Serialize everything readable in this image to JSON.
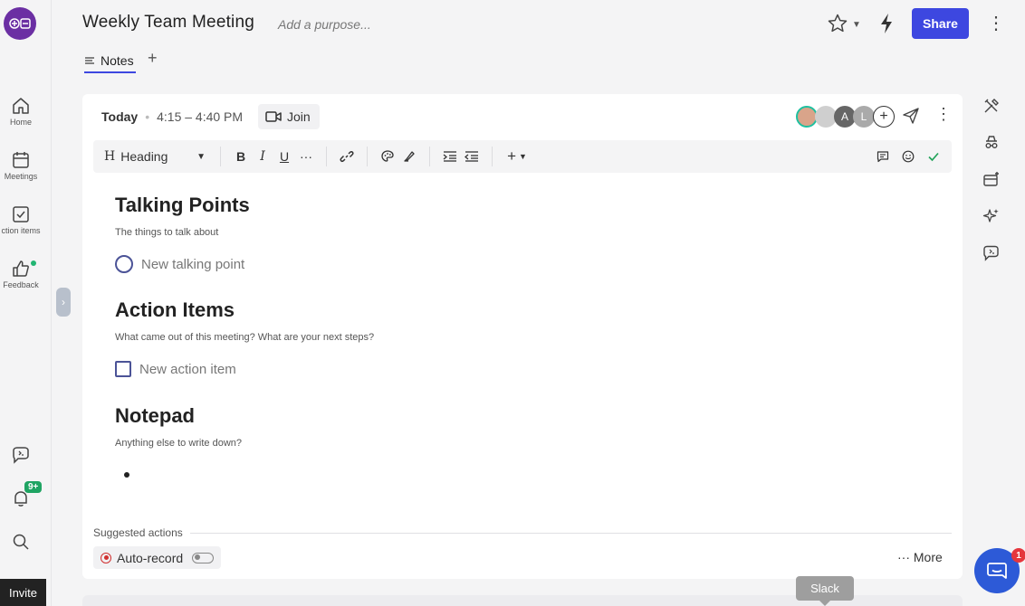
{
  "header": {
    "title": "Weekly Team Meeting",
    "purpose_placeholder": "Add a purpose...",
    "share_label": "Share"
  },
  "tabs": [
    {
      "label": "Notes",
      "active": true
    }
  ],
  "sidebar": {
    "items": [
      {
        "label": "Home",
        "icon": "home-icon"
      },
      {
        "label": "Meetings",
        "icon": "calendar-icon"
      },
      {
        "label": "ction items",
        "icon": "checkbox-icon"
      },
      {
        "label": "Feedback",
        "icon": "thumbs-up-icon"
      }
    ],
    "notifications_badge": "9+",
    "invite_label": "Invite"
  },
  "meeting": {
    "day": "Today",
    "time": "4:15 – 4:40 PM",
    "join_label": "Join",
    "attendees": [
      {
        "initial": "",
        "color": "#d9a48a"
      },
      {
        "initial": "",
        "color": "#cfcfcf"
      },
      {
        "initial": "A",
        "color": "#666666"
      },
      {
        "initial": "L",
        "color": "#aaaaaa"
      }
    ]
  },
  "toolbar": {
    "block_style": "Heading",
    "block_icon": "H"
  },
  "sections": {
    "talking": {
      "title": "Talking Points",
      "subtitle": "The things to talk about",
      "placeholder": "New talking point"
    },
    "actions": {
      "title": "Action Items",
      "subtitle": "What came out of this meeting? What are your next steps?",
      "placeholder": "New action item"
    },
    "notepad": {
      "title": "Notepad",
      "subtitle": "Anything else to write down?"
    }
  },
  "suggested": {
    "label": "Suggested actions",
    "autorecord_label": "Auto-record",
    "more_label": "More"
  },
  "chat": {
    "badge": "1"
  },
  "tooltip": {
    "text": "Slack"
  },
  "colors": {
    "accent": "#3d47e0",
    "logo": "#6b2fa3",
    "checkbox": "#4b5397",
    "record": "#d03030",
    "chat": "#2d5ad7"
  }
}
